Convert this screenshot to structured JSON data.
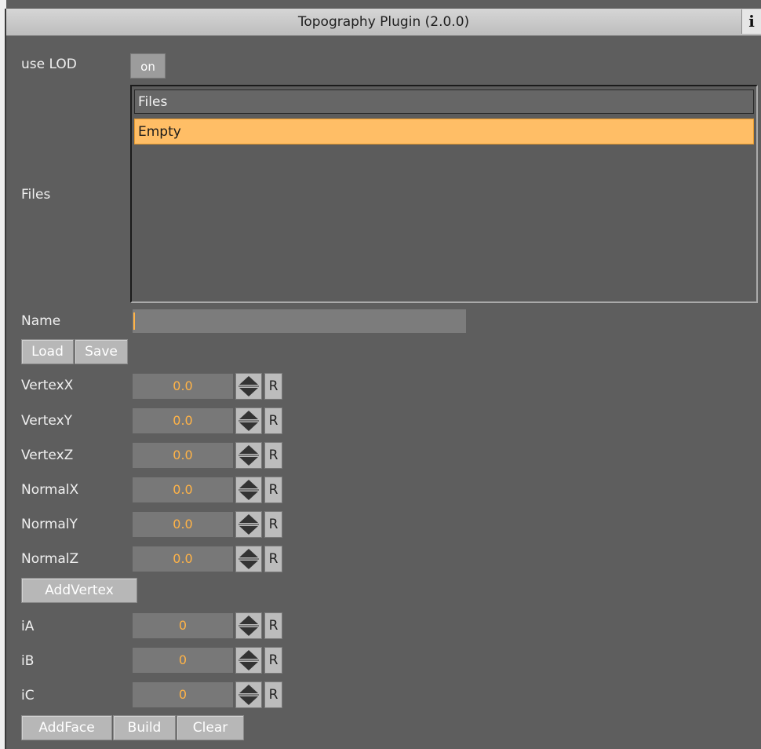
{
  "window": {
    "title": "Topography Plugin (2.0.0)",
    "info_label": "i"
  },
  "use_lod": {
    "label": "use LOD",
    "value": "on"
  },
  "files": {
    "label": "Files",
    "header": "Files",
    "items": [
      "Empty"
    ]
  },
  "name": {
    "label": "Name",
    "value": ""
  },
  "buttons": {
    "load": "Load",
    "save": "Save",
    "add_vertex": "AddVertex",
    "add_face": "AddFace",
    "build": "Build",
    "clear": "Clear"
  },
  "vertex_fields": [
    {
      "label": "VertexX",
      "value": "0.0",
      "reset": "R"
    },
    {
      "label": "VertexY",
      "value": "0.0",
      "reset": "R"
    },
    {
      "label": "VertexZ",
      "value": "0.0",
      "reset": "R"
    },
    {
      "label": "NormalX",
      "value": "0.0",
      "reset": "R"
    },
    {
      "label": "NormalY",
      "value": "0.0",
      "reset": "R"
    },
    {
      "label": "NormalZ",
      "value": "0.0",
      "reset": "R"
    }
  ],
  "face_fields": [
    {
      "label": "iA",
      "value": "0",
      "reset": "R"
    },
    {
      "label": "iB",
      "value": "0",
      "reset": "R"
    },
    {
      "label": "iC",
      "value": "0",
      "reset": "R"
    }
  ],
  "colors": {
    "accent": "#ffb347",
    "selection": "#ffbe66",
    "background": "#5e5e5e"
  }
}
